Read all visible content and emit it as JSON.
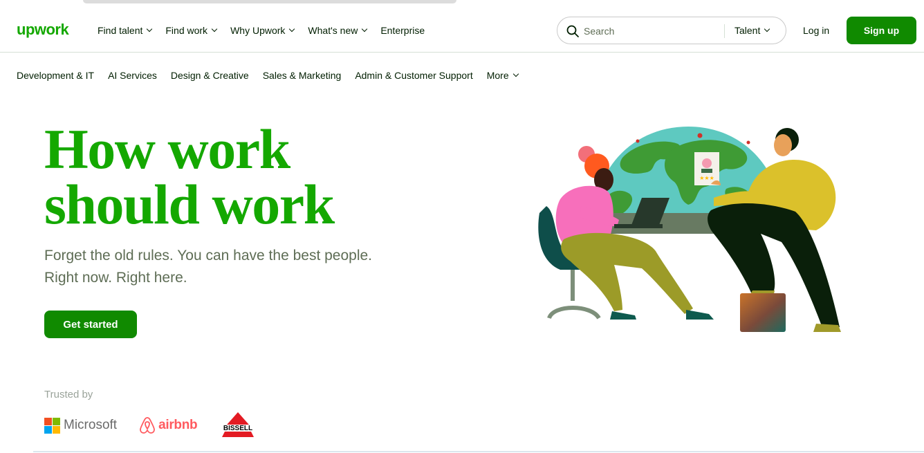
{
  "header": {
    "logo": "upwork",
    "nav": [
      {
        "label": "Find talent",
        "dropdown": true
      },
      {
        "label": "Find work",
        "dropdown": true
      },
      {
        "label": "Why Upwork",
        "dropdown": true
      },
      {
        "label": "What's new",
        "dropdown": true
      },
      {
        "label": "Enterprise",
        "dropdown": false
      }
    ],
    "search": {
      "placeholder": "Search",
      "scope": "Talent"
    },
    "login": "Log in",
    "signup": "Sign up"
  },
  "categories": [
    "Development & IT",
    "AI Services",
    "Design & Creative",
    "Sales & Marketing",
    "Admin & Customer Support",
    "More"
  ],
  "hero": {
    "title_line1": "How work",
    "title_line2": "should work",
    "subtitle_line1": "Forget the old rules. You can have the best people.",
    "subtitle_line2": "Right now. Right here.",
    "cta": "Get started"
  },
  "trusted": {
    "label": "Trusted by",
    "brands": [
      "Microsoft",
      "airbnb",
      "BISSELL"
    ]
  },
  "colors": {
    "brand_green": "#14a800",
    "button_green": "#108a00",
    "text_dark": "#001e00",
    "text_muted": "#5e6d55"
  }
}
